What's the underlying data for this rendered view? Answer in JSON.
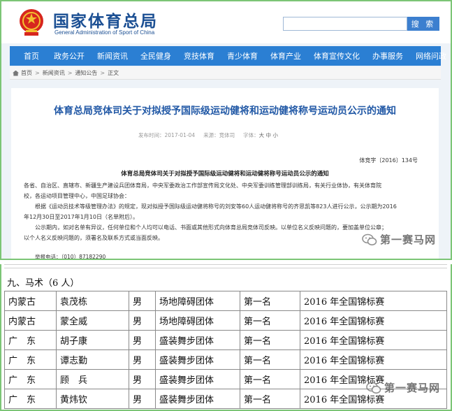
{
  "header": {
    "site_title": "国家体育总局",
    "site_subtitle": "General Administration of Sport of China",
    "search_placeholder": "",
    "search_button": "搜 索"
  },
  "nav": {
    "items": [
      "首页",
      "政务公开",
      "新闻资讯",
      "全民健身",
      "竞技体育",
      "青少体育",
      "体育产业",
      "体育宣传文化",
      "办事服务",
      "网络问政"
    ]
  },
  "breadcrumb": [
    "首页",
    "新闻资讯",
    "通知公告",
    "正文"
  ],
  "article": {
    "title": "体育总局竞体司关于对拟授予国际级运动健将和运动健将称号运动员公示的通知",
    "meta": {
      "date_label": "发布时间：",
      "date_value": "2017-01-04",
      "source_label": "来源：",
      "source_value": "竞体司",
      "font_label": "字体：",
      "font_sizes": "大 中 小"
    },
    "doc_number": "体竞字〔2016〕134号",
    "subhead": "体育总局竞体司关于对拟授予国际级运动健将和运动健将称号运动员公示的通知",
    "paragraphs": [
      "各省、自治区、直辖市、新疆生产建设兵团体育局，中央军委政治工作部宣传局文化处、中央军委训练管理部训练局，有关行业体协，有关体育院",
      "校，各运动项目管理中心，中国足球协会：",
      "根据《运动员技术等级管理办法》的规定，现对拟授予国际级运动健将称号的刘安等60人运动健将称号的齐思凯等823人进行公示，公示期为2016",
      "年12月30日至2017年1月10日（名单附后）。",
      "公示期内，如对名单有异议，任何单位和个人均可以电话、书面或其他形式向体育总局竞体司反映。以单位名义反映问题的，要加盖单位公章；",
      "以个人名义反映问题的，须署名及联系方式或当面反映。"
    ],
    "contact": "举报电话：（010）87182290"
  },
  "watermark": "第一赛马网",
  "table": {
    "section_title": "九、马术（6 人）",
    "rows": [
      [
        "内蒙古",
        "袁茂栋",
        "男",
        "场地障碍团体",
        "第一名",
        "2016 年全国锦标赛"
      ],
      [
        "内蒙古",
        "蒙全威",
        "男",
        "场地障碍团体",
        "第一名",
        "2016 年全国锦标赛"
      ],
      [
        "广　东",
        "胡子康",
        "男",
        "盛装舞步团体",
        "第一名",
        "2016 年全国锦标赛"
      ],
      [
        "广　东",
        "谭志勤",
        "男",
        "盛装舞步团体",
        "第一名",
        "2016 年全国锦标赛"
      ],
      [
        "广　东",
        "顾　兵",
        "男",
        "盛装舞步团体",
        "第一名",
        "2016 年全国锦标赛"
      ],
      [
        "广　东",
        "黄炜钦",
        "男",
        "盛装舞步团体",
        "第一名",
        "2016 年全国锦标赛"
      ]
    ]
  },
  "colors": {
    "nav_blue": "#2b7fd3",
    "title_blue": "#2259a6",
    "frame_green": "#7cc576"
  }
}
